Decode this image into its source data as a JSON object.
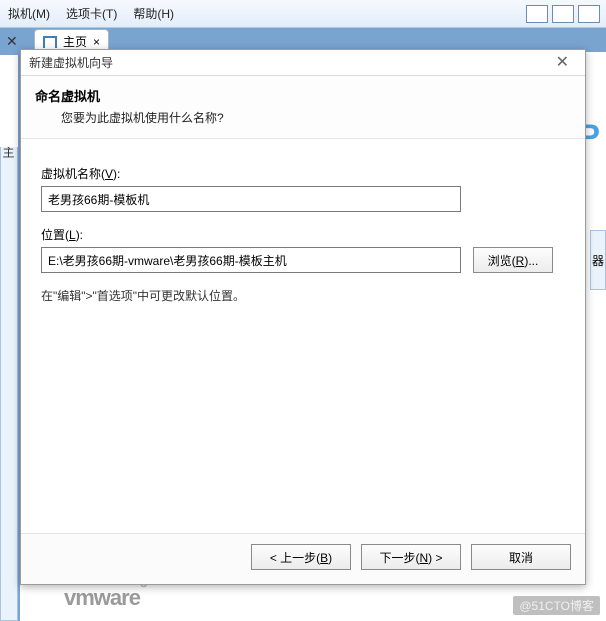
{
  "background": {
    "menu_items": [
      "选项卡(T)",
      "帮助(H)"
    ],
    "menu_items_cut": "拟机(M)",
    "tab_label": "主页",
    "tab_close": "×",
    "side_label": "主",
    "right_label": "器",
    "brand": "vmware",
    "big_w": "P",
    "watermark": "@51CTO博客"
  },
  "dialog": {
    "title": "新建虚拟机向导",
    "header_title": "命名虚拟机",
    "header_sub": "您要为此虚拟机使用什么名称?",
    "vm_name_label_pre": "虚拟机名称(",
    "vm_name_label_u": "V",
    "vm_name_label_post": "):",
    "vm_name_value": "老男孩66期-模板机",
    "location_label_pre": "位置(",
    "location_label_u": "L",
    "location_label_post": "):",
    "location_value": "E:\\老男孩66期-vmware\\老男孩66期-模板主机",
    "browse_pre": "浏览(",
    "browse_u": "R",
    "browse_post": ")...",
    "hint": "在\"编辑\">\"首选项\"中可更改默认位置。",
    "back_pre": "< 上一步(",
    "back_u": "B",
    "back_post": ")",
    "next_pre": "下一步(",
    "next_u": "N",
    "next_post": ") >",
    "cancel": "取消"
  }
}
